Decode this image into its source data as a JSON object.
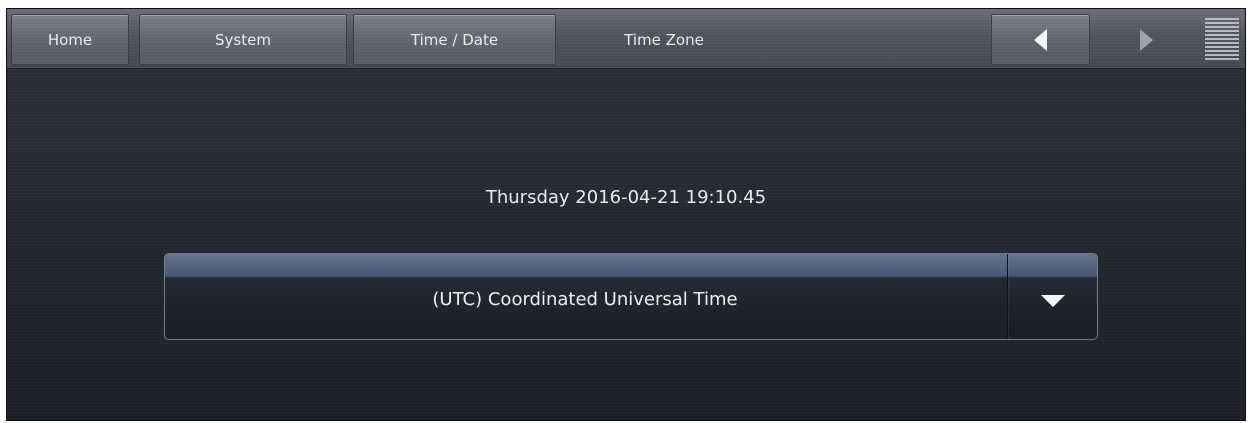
{
  "topbar": {
    "breadcrumbs": [
      {
        "label": "Home"
      },
      {
        "label": "System"
      },
      {
        "label": "Time / Date"
      }
    ],
    "current_page": "Time Zone",
    "icons": {
      "back": "triangle-left-icon",
      "forward": "triangle-right-icon",
      "menu": "hamburger-menu-icon"
    }
  },
  "main": {
    "datetime": "Thursday 2016-04-21 19:10.45",
    "timezone_select": {
      "selected": "(UTC) Coordinated Universal Time",
      "dropdown_icon": "triangle-down-icon"
    }
  }
}
